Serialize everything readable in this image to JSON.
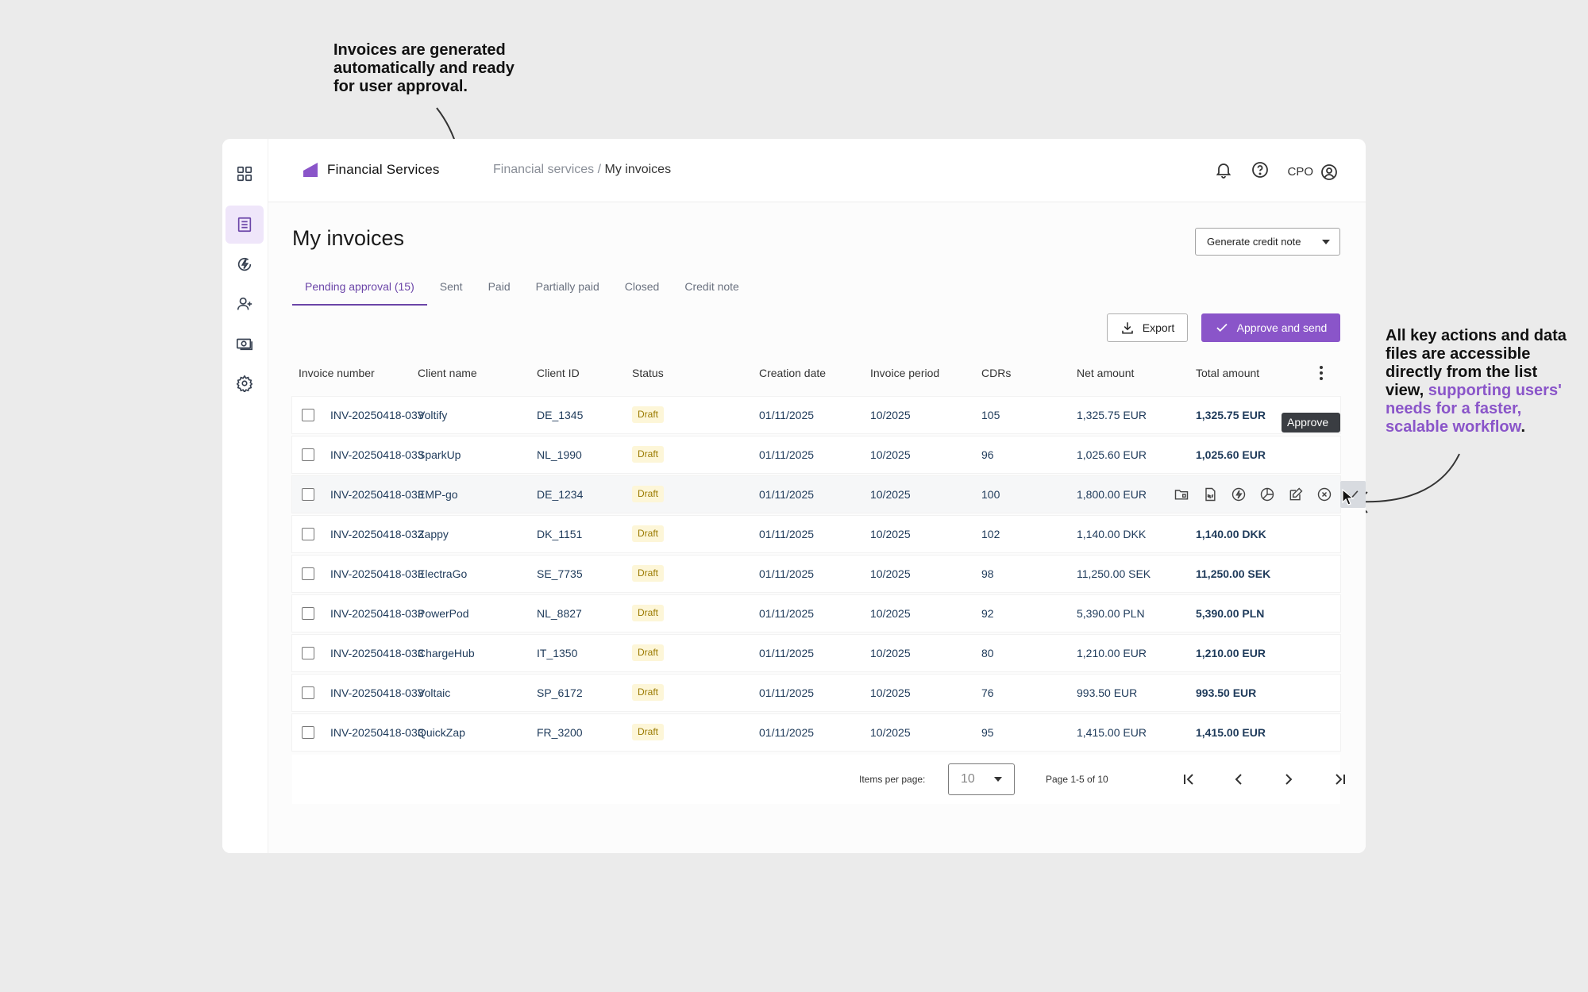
{
  "annotations": {
    "top": "Invoices are generated automatically and ready for user approval.",
    "right_plain": "All key actions and data files are accessible directly from the list view, ",
    "right_highlight": "supporting users' needs for a faster, scalable workflow",
    "right_end": "."
  },
  "app": {
    "brand": "Financial Services",
    "breadcrumb": {
      "parent": "Financial services",
      "separator": " / ",
      "current": "My invoices"
    },
    "user_label": "CPO",
    "rail_icons": [
      "apps-grid-icon",
      "invoices-icon",
      "charging-icon",
      "add-user-icon",
      "money-icon",
      "settings-icon"
    ]
  },
  "page": {
    "title": "My invoices",
    "generate_label": "Generate credit note",
    "export_label": "Export",
    "approve_label": "Approve and send",
    "tabs": [
      "Pending approval (15)",
      "Sent",
      "Paid",
      "Partially paid",
      "Closed",
      "Credit note"
    ]
  },
  "table": {
    "headers": [
      "Invoice number",
      "Client name",
      "Client ID",
      "Status",
      "Creation date",
      "Invoice period",
      "CDRs",
      "Net amount",
      "Total amount"
    ],
    "rows": [
      {
        "invoice": "INV-20250418-033",
        "client": "Voltify",
        "id": "DE_1345",
        "status": "Draft",
        "created": "01/11/2025",
        "period": "10/2025",
        "cdrs": "105",
        "net": "1,325.75 EUR",
        "total": "1,325.75 EUR"
      },
      {
        "invoice": "INV-20250418-033",
        "client": "SparkUp",
        "id": "NL_1990",
        "status": "Draft",
        "created": "01/11/2025",
        "period": "10/2025",
        "cdrs": "96",
        "net": "1,025.60 EUR",
        "total": "1,025.60 EUR"
      },
      {
        "invoice": "INV-20250418-033",
        "client": "EMP-go",
        "id": "DE_1234",
        "status": "Draft",
        "created": "01/11/2025",
        "period": "10/2025",
        "cdrs": "100",
        "net": "1,800.00 EUR",
        "total": ""
      },
      {
        "invoice": "INV-20250418-033",
        "client": "Zappy",
        "id": "DK_1151",
        "status": "Draft",
        "created": "01/11/2025",
        "period": "10/2025",
        "cdrs": "102",
        "net": "1,140.00 DKK",
        "total": "1,140.00 DKK"
      },
      {
        "invoice": "INV-20250418-033",
        "client": "ElectraGo",
        "id": "SE_7735",
        "status": "Draft",
        "created": "01/11/2025",
        "period": "10/2025",
        "cdrs": "98",
        "net": "11,250.00 SEK",
        "total": "11,250.00 SEK"
      },
      {
        "invoice": "INV-20250418-033",
        "client": "PowerPod",
        "id": "NL_8827",
        "status": "Draft",
        "created": "01/11/2025",
        "period": "10/2025",
        "cdrs": "92",
        "net": "5,390.00 PLN",
        "total": "5,390.00 PLN"
      },
      {
        "invoice": "INV-20250418-033",
        "client": "ChargeHub",
        "id": "IT_1350",
        "status": "Draft",
        "created": "01/11/2025",
        "period": "10/2025",
        "cdrs": "80",
        "net": "1,210.00 EUR",
        "total": "1,210.00 EUR"
      },
      {
        "invoice": "INV-20250418-033",
        "client": "Voltaic",
        "id": "SP_6172",
        "status": "Draft",
        "created": "01/11/2025",
        "period": "10/2025",
        "cdrs": "76",
        "net": "993.50 EUR",
        "total": "993.50 EUR"
      },
      {
        "invoice": "INV-20250418-033",
        "client": "QuickZap",
        "id": "FR_3200",
        "status": "Draft",
        "created": "01/11/2025",
        "period": "10/2025",
        "cdrs": "95",
        "net": "1,415.00 EUR",
        "total": "1,415.00 EUR"
      }
    ],
    "row_action_icons": [
      "folder-icon",
      "pdf-icon",
      "charging-icon",
      "pie-chart-icon",
      "edit-icon",
      "cancel-icon",
      "check-icon"
    ],
    "row_action_tooltip": "Approve and send"
  },
  "pagination": {
    "items_label": "Items per page:",
    "items_value": "10",
    "page_info": "Page 1-5 of 10"
  },
  "colors": {
    "accent": "#8a55c9",
    "accent_dark": "#6b45a8",
    "draft_bg": "#fdf6d8",
    "draft_text": "#9a7a00"
  }
}
